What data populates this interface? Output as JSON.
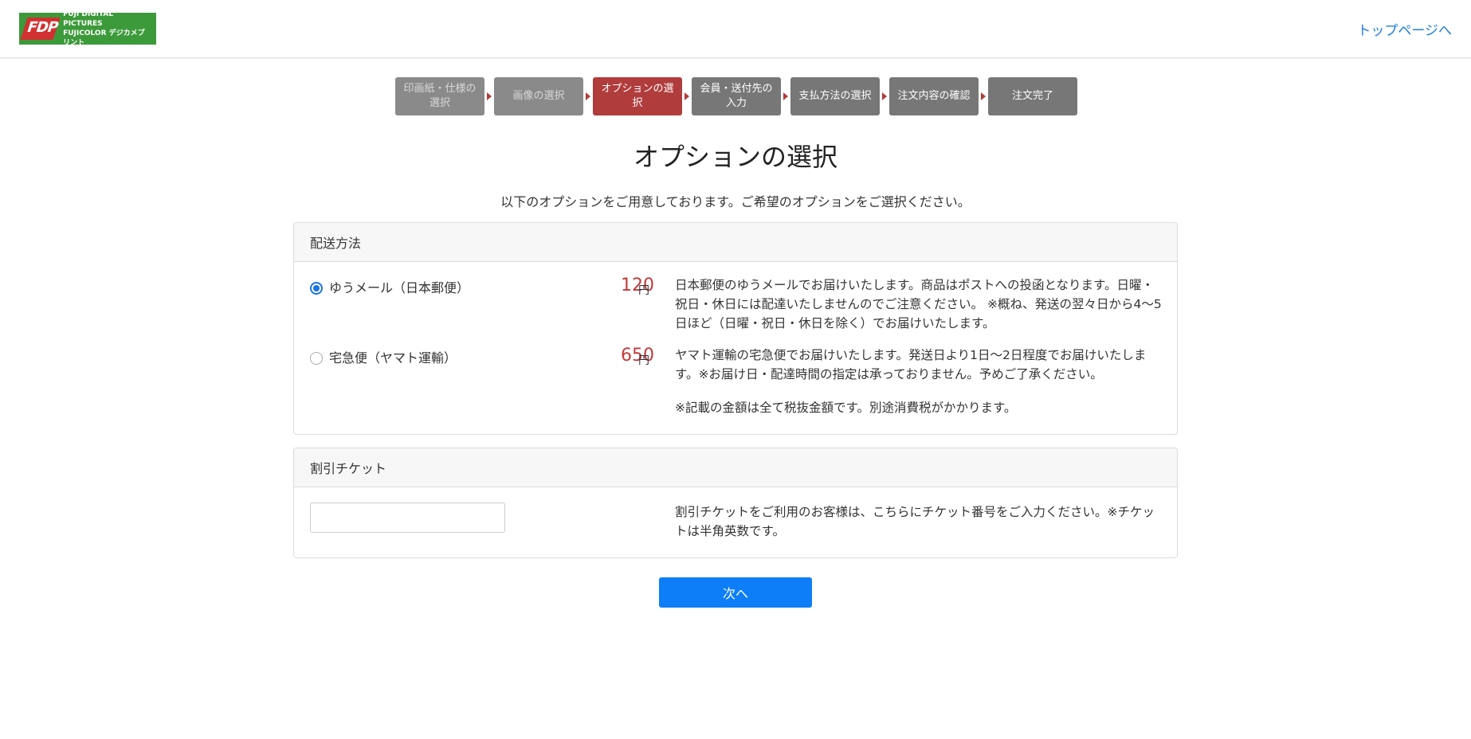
{
  "header": {
    "logo_line1": "FUJI DIGITAL PICTURES",
    "logo_line2": "FUJICOLOR デジカメプリント",
    "logo_mark": "FDP",
    "top_link": "トップページへ"
  },
  "steps": [
    {
      "label": "印画紙・仕様の選択",
      "state": "done"
    },
    {
      "label": "画像の選択",
      "state": "done"
    },
    {
      "label": "オプションの選択",
      "state": "active"
    },
    {
      "label": "会員・送付先の入力",
      "state": "future"
    },
    {
      "label": "支払方法の選択",
      "state": "future"
    },
    {
      "label": "注文内容の確認",
      "state": "future"
    },
    {
      "label": "注文完了",
      "state": "future"
    }
  ],
  "page": {
    "title": "オプションの選択",
    "subtitle": "以下のオプションをご用意しております。ご希望のオプションをご選択ください。"
  },
  "shipping": {
    "header": "配送方法",
    "options": [
      {
        "label": "ゆうメール（日本郵便）",
        "price": "120",
        "unit": "円",
        "checked": true,
        "description": "日本郵便のゆうメールでお届けいたします。商品はポストへの投函となります。日曜・祝日・休日には配達いたしませんのでご注意ください。 ※概ね、発送の翌々日から4〜5日ほど（日曜・祝日・休日を除く）でお届けいたします。"
      },
      {
        "label": "宅急便（ヤマト運輸）",
        "price": "650",
        "unit": "円",
        "checked": false,
        "description": "ヤマト運輸の宅急便でお届けいたします。発送日より1日〜2日程度でお届けいたします。※お届け日・配達時間の指定は承っておりません。予めご了承ください。"
      }
    ],
    "tax_note": "※記載の金額は全て税抜金額です。別途消費税がかかります。"
  },
  "ticket": {
    "header": "割引チケット",
    "input_value": "",
    "input_placeholder": "",
    "description": "割引チケットをご利用のお客様は、こちらにチケット番号をご入力ください。※チケットは半角英数です。"
  },
  "actions": {
    "next_label": "次へ"
  },
  "colors": {
    "accent": "#0d7ef8",
    "active_step": "#b03c3c",
    "inactive_step": "#777777",
    "price": "#c43a3a",
    "logo_bg": "#3c9a3a"
  }
}
